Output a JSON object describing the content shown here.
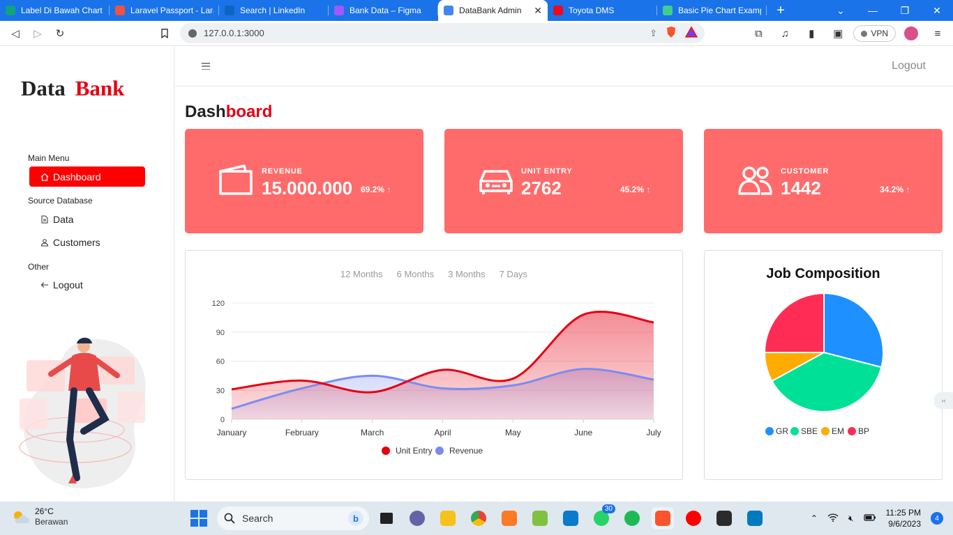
{
  "browser": {
    "tabs": [
      {
        "label": "Label Di Bawah Chart",
        "favicon": "chatgpt-icon",
        "color": "#10a37f",
        "active": false
      },
      {
        "label": "Laravel Passport - Lara",
        "favicon": "laravel-icon",
        "color": "#f05340",
        "active": false
      },
      {
        "label": "Search | LinkedIn",
        "favicon": "linkedin-icon",
        "color": "#0a66c2",
        "active": false
      },
      {
        "label": "Bank Data – Figma",
        "favicon": "figma-icon",
        "color": "#a259ff",
        "active": false
      },
      {
        "label": "DataBank Admin",
        "favicon": "google-icon",
        "color": "#4285f4",
        "active": true
      },
      {
        "label": "Toyota DMS",
        "favicon": "toyota-icon",
        "color": "#eb0a1e",
        "active": false
      },
      {
        "label": "Basic Pie Chart Exampl",
        "favicon": "chart-icon",
        "color": "#3ecf8e",
        "active": false
      }
    ],
    "url": "127.0.0.1:3000",
    "vpn_label": "VPN"
  },
  "sidebar": {
    "logo_left": "Data",
    "logo_right": "Bank",
    "main_menu_head": "Main Menu",
    "dashboard": "Dashboard",
    "source_head": "Source Database",
    "data": "Data",
    "customers": "Customers",
    "other_head": "Other",
    "logout": "Logout"
  },
  "topbar": {
    "logout": "Logout"
  },
  "page": {
    "title_part1": "Dash",
    "title_part2": "board"
  },
  "cards": [
    {
      "label": "REVENUE",
      "value": "15.000.000",
      "pct": "69.2%",
      "icon": "wallet-icon"
    },
    {
      "label": "UNIT ENTRY",
      "value": "2762",
      "pct": "45.2%",
      "icon": "car-icon"
    },
    {
      "label": "CUSTOMER",
      "value": "1442",
      "pct": "34.2%",
      "icon": "users-icon"
    }
  ],
  "colors": {
    "accent": "#ff0000",
    "card_bg": "#ff6b6b",
    "unit_entry": "#e60012",
    "revenue": "#7b8cf0"
  },
  "line_filters": [
    "12 Months",
    "6 Months",
    "3 Months",
    "7 Days"
  ],
  "pie_title": "Job Composition",
  "chart_data": [
    {
      "type": "area",
      "categories": [
        "January",
        "February",
        "March",
        "April",
        "May",
        "June",
        "July"
      ],
      "ylim": [
        0,
        120
      ],
      "yticks": [
        0,
        30,
        60,
        90,
        120
      ],
      "grid": true,
      "legend": "bottom",
      "series": [
        {
          "name": "Unit Entry",
          "color": "#e60012",
          "values": [
            31,
            40,
            28,
            51,
            42,
            108,
            100
          ]
        },
        {
          "name": "Revenue",
          "color": "#7b8cf0",
          "values": [
            11,
            32,
            45,
            32,
            35,
            52,
            41
          ]
        }
      ]
    },
    {
      "type": "pie",
      "title": "Job Composition",
      "legend": "bottom",
      "categories": [
        "GR",
        "SBE",
        "EM",
        "BP"
      ],
      "values": [
        29,
        38,
        8,
        25
      ],
      "colors": [
        "#1e90ff",
        "#00e096",
        "#ffab00",
        "#ff2d55"
      ]
    }
  ],
  "taskbar": {
    "temp": "26°C",
    "weather": "Berawan",
    "search": "Search",
    "time": "11:25 PM",
    "date": "9/6/2023",
    "notifications": "4",
    "whatsapp_badge": "30"
  }
}
